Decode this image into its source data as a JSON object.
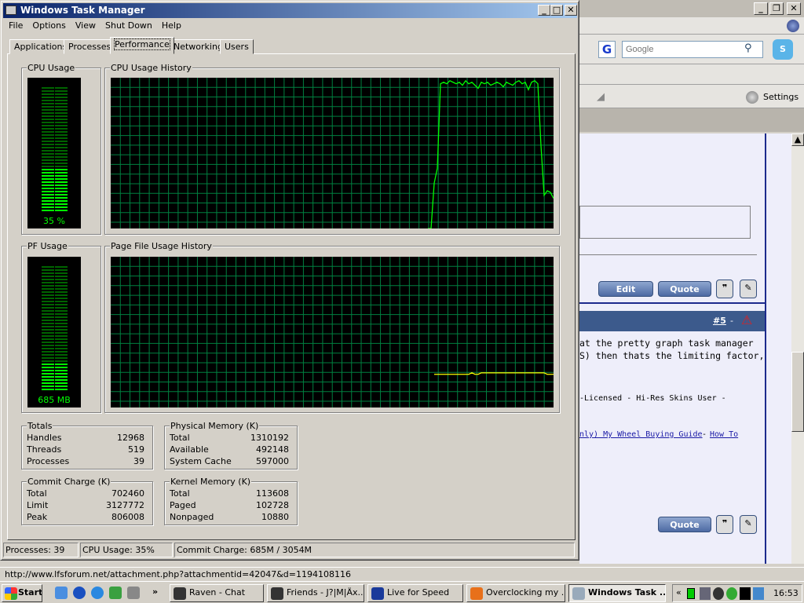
{
  "task_manager": {
    "title": "Windows Task Manager",
    "window_buttons": [
      "_",
      "□",
      "✕"
    ],
    "menu": [
      "File",
      "Options",
      "View",
      "Shut Down",
      "Help"
    ],
    "tabs": [
      {
        "label": "Applications",
        "active": false
      },
      {
        "label": "Processes",
        "active": false
      },
      {
        "label": "Performance",
        "active": true
      },
      {
        "label": "Networking",
        "active": false
      },
      {
        "label": "Users",
        "active": false
      }
    ],
    "cpu_usage": {
      "label": "CPU Usage",
      "value_text": "35 %",
      "percent": 35
    },
    "cpu_history": {
      "label": "CPU Usage History"
    },
    "pf_usage": {
      "label": "PF Usage",
      "value_text": "685 MB",
      "percent": 22
    },
    "pf_history": {
      "label": "Page File Usage History"
    },
    "totals": {
      "label": "Totals",
      "rows": [
        {
          "name": "Handles",
          "value": "12968"
        },
        {
          "name": "Threads",
          "value": "519"
        },
        {
          "name": "Processes",
          "value": "39"
        }
      ]
    },
    "physical_memory": {
      "label": "Physical Memory (K)",
      "rows": [
        {
          "name": "Total",
          "value": "1310192"
        },
        {
          "name": "Available",
          "value": "492148"
        },
        {
          "name": "System Cache",
          "value": "597000"
        }
      ]
    },
    "commit_charge": {
      "label": "Commit Charge (K)",
      "rows": [
        {
          "name": "Total",
          "value": "702460"
        },
        {
          "name": "Limit",
          "value": "3127772"
        },
        {
          "name": "Peak",
          "value": "806008"
        }
      ]
    },
    "kernel_memory": {
      "label": "Kernel Memory (K)",
      "rows": [
        {
          "name": "Total",
          "value": "113608"
        },
        {
          "name": "Paged",
          "value": "102728"
        },
        {
          "name": "Nonpaged",
          "value": "10880"
        }
      ]
    },
    "status": {
      "processes": "Processes: 39",
      "cpu": "CPU Usage: 35%",
      "commit": "Commit Charge: 685M / 3054M"
    }
  },
  "chart_data": [
    {
      "type": "line",
      "title": "CPU Usage History",
      "ylim": [
        0,
        100
      ],
      "grid": true,
      "colors": {
        "line": "#00ff00",
        "grid": "#008040",
        "background": "#000000"
      },
      "values": [
        0,
        0,
        30,
        40,
        96,
        97,
        96,
        98,
        97,
        96,
        97,
        95,
        98,
        96,
        97,
        95,
        93,
        97,
        96,
        97,
        95,
        96,
        97,
        96,
        94,
        97,
        96,
        95,
        97,
        98,
        96,
        97,
        92,
        97,
        98,
        96,
        55,
        22,
        25,
        24,
        20
      ]
    },
    {
      "type": "line",
      "title": "Page File Usage History",
      "ylim": [
        0,
        100
      ],
      "grid": true,
      "colors": {
        "line": "#ffff00",
        "grid": "#008040",
        "background": "#000000"
      },
      "values": [
        22,
        22,
        22,
        22,
        22,
        22,
        22,
        22,
        22,
        22,
        22,
        22,
        23,
        22,
        22,
        23,
        23,
        23,
        23,
        23,
        23,
        23,
        23,
        23,
        23,
        23,
        23,
        23,
        23,
        23,
        23,
        23,
        23,
        23,
        23,
        23,
        22,
        22,
        22
      ]
    }
  ],
  "browser": {
    "search_placeholder": "Google",
    "settings_label": "Settings",
    "edit_label": "Edit",
    "quote_label": "Quote",
    "post_number": "#5",
    "post_sep": "-",
    "post_lines": [
      "at the pretty graph task manager",
      "S) then thats the limiting factor,"
    ],
    "signature": "-Licensed - Hi-Res Skins User -",
    "link1": "nly) My Wheel Buying Guide",
    "link_sep": "-",
    "link2": "How To",
    "status_url": "http://www.lfsforum.net/attachment.php?attachmentid=42047&d=1194108116"
  },
  "taskbar": {
    "start_label": "Start",
    "chevron": "»",
    "tasks": [
      {
        "label": "Raven - Chat",
        "icon": "steam-icon",
        "active": false
      },
      {
        "label": "Friends - J?|M|Äx...",
        "icon": "steam-icon",
        "active": false
      },
      {
        "label": "Live for Speed",
        "icon": "lfs-icon",
        "active": false
      },
      {
        "label": "Overclocking my ...",
        "icon": "firefox-icon",
        "active": false
      },
      {
        "label": "Windows Task ...",
        "icon": "task-manager-icon",
        "active": true
      }
    ],
    "tray_chevron": "«",
    "clock": "16:53"
  }
}
